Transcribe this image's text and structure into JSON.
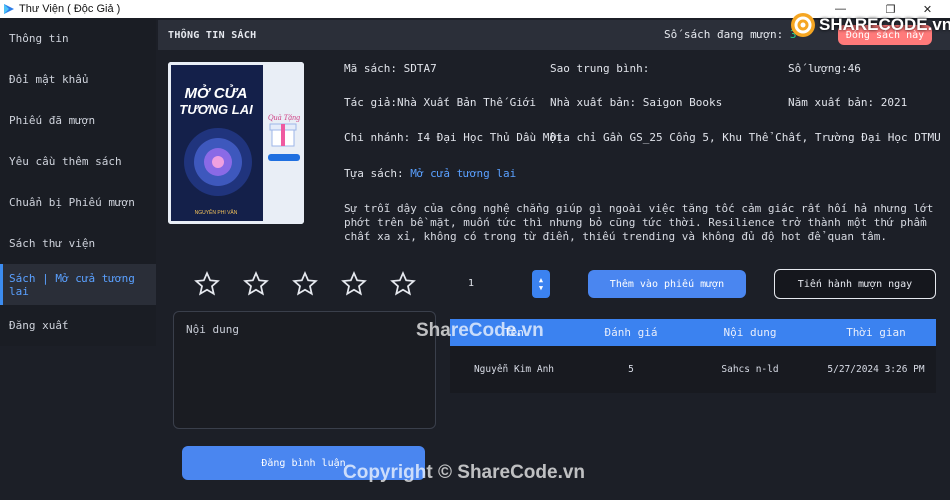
{
  "window": {
    "title": "Thư Viện ( Độc Giả )",
    "minimize": "—",
    "restore": "❐",
    "close": "✕"
  },
  "sidebar": {
    "items": [
      {
        "label": "Thông tin"
      },
      {
        "label": "Đổi mật khẩu"
      },
      {
        "label": "Phiếu đã mượn"
      },
      {
        "label": "Yêu cầu thêm sách"
      },
      {
        "label": "Chuẩn bị Phiếu mượn"
      },
      {
        "label": "Sách thư viện"
      },
      {
        "label": "Sách | Mở cửa tương lai"
      },
      {
        "label": "Đăng xuất"
      }
    ],
    "active_index": 6
  },
  "header": {
    "title": "THÔNG TIN SÁCH",
    "borrowing_label": "Số sách đang mượn:",
    "borrowing_count": "3",
    "return_button": "Đóng sách này"
  },
  "book": {
    "cover": {
      "title_line1": "MỞ CỬA",
      "title_line2": "TƯƠNG LAI",
      "author": "NGUYỄN PHI VÂN",
      "gift": "Quà Tặng"
    },
    "code_label": "Mã sách:",
    "code": "SDTA7",
    "rating_label": "Sao trung bình:",
    "rating": "",
    "quantity_label": "Số lượng:",
    "quantity": "46",
    "author_label": "Tác giả:",
    "author": "Nhà Xuất Bản Thế Giới",
    "publisher_label": "Nhà xuất bản:",
    "publisher": "Saigon Books",
    "year_label": "Năm xuất bản:",
    "year": "2021",
    "branch_label": "Chi nhánh:",
    "branch": "I4 Đại Học Thủ Dầu Một",
    "address_label": "Địa chỉ",
    "address": "Gần GS_25 Cổng 5, Khu Thể Chất, Trường Đại Học DTMU",
    "title_label": "Tựa sách:",
    "title": "Mở cửa tương lai",
    "description": "Sự trỗi dậy của công nghệ chẳng giúp gì ngoài việc tăng tốc cảm giác rất hối hả nhưng lớt phớt trên bề mặt, muốn tức thì nhưng bỏ cũng tức thời. Resilience trở thành một thứ phẩm chất xa xỉ, không có trong từ điển, thiếu trending và không đủ độ hot để quan tâm."
  },
  "rating_input": {
    "stars": 5,
    "selected": 0
  },
  "quantity_input": {
    "value": "1",
    "up": "▲",
    "down": "▼"
  },
  "actions": {
    "add_to_slip": "Thêm vào phiếu mượn",
    "borrow_now": "Tiến hành mượn ngay"
  },
  "comment": {
    "placeholder": "Nội dung",
    "submit": "Đăng bình luận"
  },
  "reviews": {
    "columns": [
      "Tên",
      "Đánh giá",
      "Nội dung",
      "Thời gian"
    ],
    "rows": [
      [
        "Nguyễn Kim Anh",
        "5",
        "Sahcs n-ld",
        "5/27/2024 3:26 PM"
      ]
    ]
  },
  "watermark": {
    "logo": "SHARECODE.vn",
    "center": "ShareCode.vn",
    "footer": "Copyright © ShareCode.vn"
  },
  "colors": {
    "accent": "#3b82f0",
    "danger": "#ff7a7a",
    "count": "#28d08a",
    "bg": "#1c1f27"
  }
}
